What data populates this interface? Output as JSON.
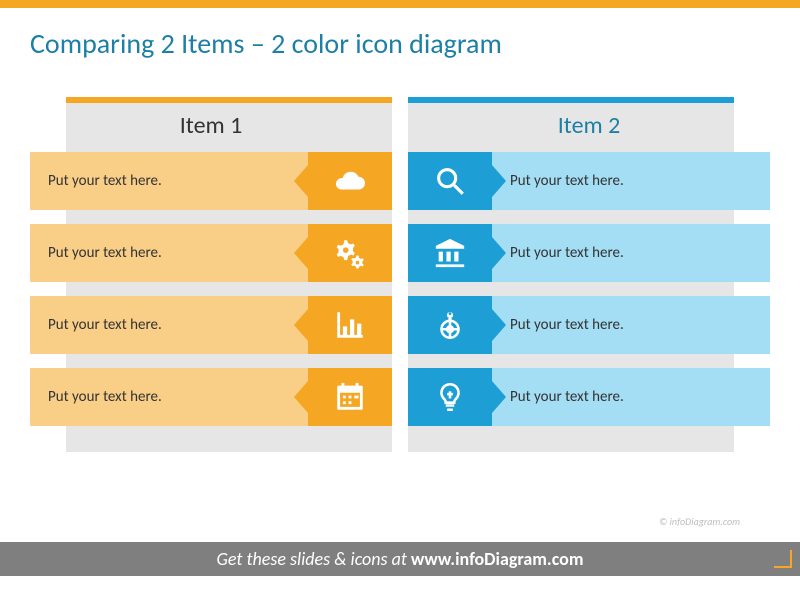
{
  "title": "Comparing 2 Items – 2 color icon diagram",
  "columns": {
    "left": {
      "header": "Item 1",
      "rows": [
        {
          "text": "Put your text here.",
          "icon": "cloud-icon"
        },
        {
          "text": "Put your text here.",
          "icon": "gears-icon"
        },
        {
          "text": "Put your text here.",
          "icon": "bar-chart-icon"
        },
        {
          "text": "Put your text here.",
          "icon": "calendar-icon"
        }
      ]
    },
    "right": {
      "header": "Item 2",
      "rows": [
        {
          "text": "Put your text here.",
          "icon": "magnifier-icon"
        },
        {
          "text": "Put your text here.",
          "icon": "bank-icon"
        },
        {
          "text": "Put your text here.",
          "icon": "target-pin-icon"
        },
        {
          "text": "Put your text here.",
          "icon": "lightbulb-icon"
        }
      ]
    }
  },
  "watermark": "© infoDiagram.com",
  "footer_prefix": "Get these slides & icons at ",
  "footer_domain": "www.infoDiagram.com"
}
